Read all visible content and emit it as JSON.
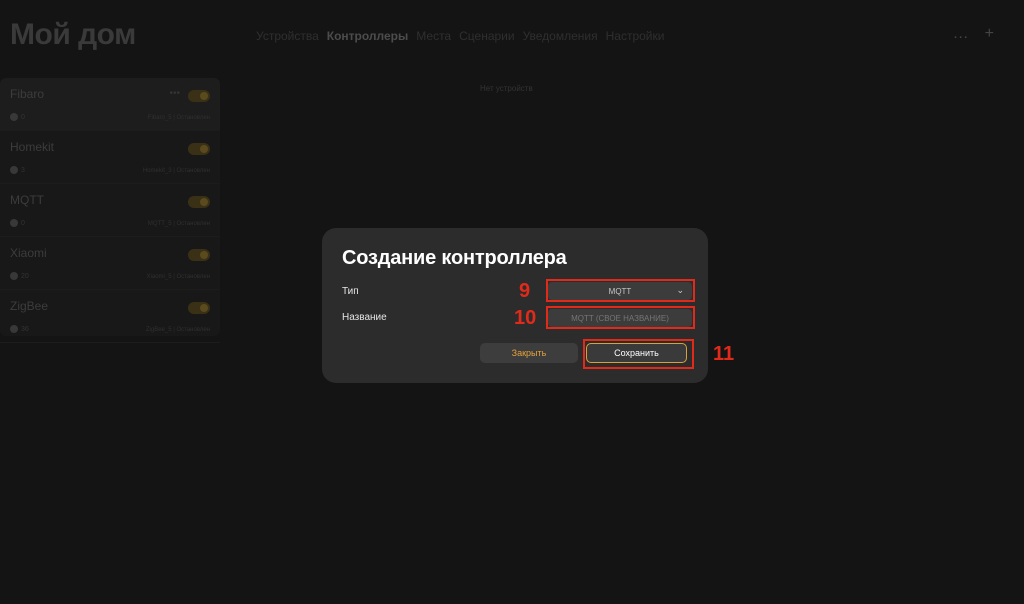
{
  "app": {
    "title": "Мой дом",
    "nav": [
      "Устройства",
      "Контроллеры",
      "Места",
      "Сценарии",
      "Уведомления",
      "Настройки"
    ],
    "nav_active": 1,
    "more_icon": "…",
    "add_icon": "+",
    "controllers": [
      {
        "name": "Fibaro",
        "count": "0",
        "status": "Fibaro_5 | Остановлен"
      },
      {
        "name": "Homekit",
        "count": "3",
        "status": "Homekit_3 | Остановлен"
      },
      {
        "name": "MQTT",
        "count": "0",
        "status": "MQTT_5 | Остановлен"
      },
      {
        "name": "Xiaomi",
        "count": "20",
        "status": "Xiaomi_5 | Остановлен"
      },
      {
        "name": "ZigBee",
        "count": "36",
        "status": "ZigBee_5 | Остановлен"
      }
    ],
    "empty_text": "Нет устройств"
  },
  "modal": {
    "title": "Создание контроллера",
    "type_label": "Тип",
    "type_value": "MQTT",
    "name_label": "Название",
    "name_placeholder": "MQTT (СВОЕ НАЗВАНИЕ)",
    "close_label": "Закрыть",
    "save_label": "Сохранить"
  },
  "annotations": {
    "type_marker": "9",
    "name_marker": "10",
    "save_marker": "11",
    "color": "#e22a1b"
  },
  "colors": {
    "accent": "#d8a23a",
    "modal_bg": "#2c2c2c",
    "page_bg": "#141414"
  }
}
